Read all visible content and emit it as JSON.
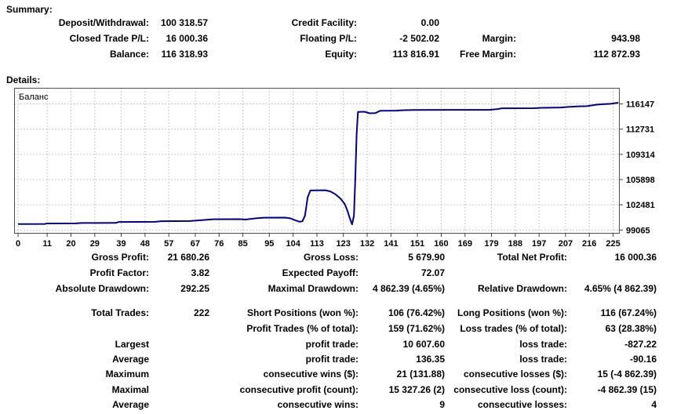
{
  "headers": {
    "summary": "Summary:",
    "details": "Details:"
  },
  "summary": {
    "rows": [
      {
        "c1l": "Deposit/Withdrawal:",
        "c1v": "100 318.57",
        "c2l": "Credit Facility:",
        "c2v": "0.00",
        "c3l": "",
        "c3v": ""
      },
      {
        "c1l": "Closed Trade P/L:",
        "c1v": "16 000.36",
        "c2l": "Floating P/L:",
        "c2v": "-2 502.02",
        "c3l": "Margin:",
        "c3v": "943.98"
      },
      {
        "c1l": "Balance:",
        "c1v": "116 318.93",
        "c2l": "Equity:",
        "c2v": "113 816.91",
        "c3l": "Free Margin:",
        "c3v": "112 872.93"
      }
    ]
  },
  "results": {
    "rows": [
      {
        "c1l": "Gross Profit:",
        "c1v": "21 680.26",
        "c2l": "Gross Loss:",
        "c2v": "5 679.90",
        "c3l": "Total Net Profit:",
        "c3v": "16 000.36"
      },
      {
        "c1l": "Profit Factor:",
        "c1v": "3.82",
        "c2l": "Expected Payoff:",
        "c2v": "72.07",
        "c3l": "",
        "c3v": ""
      },
      {
        "c1l": "Absolute Drawdown:",
        "c1v": "292.25",
        "c2l": "Maximal Drawdown:",
        "c2v": "4 862.39 (4.65%)",
        "c3l": "Relative Drawdown:",
        "c3v": "4.65% (4 862.39)"
      }
    ]
  },
  "trades": {
    "rows": [
      {
        "c1l": "Total Trades:",
        "c1v": "222",
        "c2l": "Short Positions (won %):",
        "c2v": "106 (76.42%)",
        "c3l": "Long Positions (won %):",
        "c3v": "116 (67.24%)"
      },
      {
        "c1l": "",
        "c1v": "",
        "c2l": "Profit Trades (% of total):",
        "c2v": "159 (71.62%)",
        "c3l": "Loss trades (% of total):",
        "c3v": "63 (28.38%)"
      },
      {
        "c1l": "Largest",
        "c1v": "",
        "c2l": "profit trade:",
        "c2v": "10 607.60",
        "c3l": "loss trade:",
        "c3v": "-827.22"
      },
      {
        "c1l": "Average",
        "c1v": "",
        "c2l": "profit trade:",
        "c2v": "136.35",
        "c3l": "loss trade:",
        "c3v": "-90.16"
      },
      {
        "c1l": "Maximum",
        "c1v": "",
        "c2l": "consecutive wins ($):",
        "c2v": "21 (131.88)",
        "c3l": "consecutive losses ($):",
        "c3v": "15 (-4 862.39)"
      },
      {
        "c1l": "Maximal",
        "c1v": "",
        "c2l": "consecutive profit (count):",
        "c2v": "15 327.26 (2)",
        "c3l": "consecutive loss (count):",
        "c3v": "-4 862.39 (15)"
      },
      {
        "c1l": "Average",
        "c1v": "",
        "c2l": "consecutive wins:",
        "c2v": "9",
        "c3l": "consecutive losses:",
        "c3v": "4"
      }
    ]
  },
  "chart_data": {
    "type": "line",
    "title": "Баланс",
    "xlabel": "",
    "ylabel": "",
    "grid": true,
    "legend_position": "inside-top-left",
    "x_ticks": [
      0,
      11,
      20,
      29,
      39,
      48,
      57,
      67,
      76,
      85,
      95,
      104,
      113,
      123,
      132,
      141,
      151,
      160,
      169,
      179,
      188,
      197,
      207,
      216,
      225
    ],
    "y_ticks": [
      99065,
      102481,
      105898,
      109314,
      112731,
      116147
    ],
    "xlim": [
      -1.5,
      227.5
    ],
    "ylim": [
      98570,
      118330
    ],
    "colors": {
      "line": "#00008B",
      "grid": "#c8c8c8",
      "border": "#4d4d4d",
      "tick": "#404040"
    },
    "series": [
      {
        "name": "Баланс",
        "points": [
          [
            0,
            99880
          ],
          [
            10,
            99890
          ],
          [
            11,
            99950
          ],
          [
            22,
            99960
          ],
          [
            24,
            100010
          ],
          [
            37,
            100030
          ],
          [
            38,
            100150
          ],
          [
            52,
            100170
          ],
          [
            54,
            100260
          ],
          [
            65,
            100280
          ],
          [
            67,
            100330
          ],
          [
            70,
            100420
          ],
          [
            74,
            100520
          ],
          [
            84,
            100540
          ],
          [
            86,
            100480
          ],
          [
            90,
            100650
          ],
          [
            93,
            100740
          ],
          [
            101,
            100750
          ],
          [
            103,
            100640
          ],
          [
            105,
            100350
          ],
          [
            106.5,
            100180
          ],
          [
            107.5,
            100250
          ],
          [
            108.5,
            101000
          ],
          [
            109.5,
            103500
          ],
          [
            110.5,
            104420
          ],
          [
            116,
            104460
          ],
          [
            118,
            104310
          ],
          [
            120,
            103900
          ],
          [
            122,
            103300
          ],
          [
            123.5,
            102600
          ],
          [
            124.5,
            101700
          ],
          [
            125.5,
            100600
          ],
          [
            126.3,
            99830
          ],
          [
            127,
            101000
          ],
          [
            127.5,
            106000
          ],
          [
            128,
            112000
          ],
          [
            128.5,
            115060
          ],
          [
            131,
            115090
          ],
          [
            133,
            114880
          ],
          [
            135,
            114900
          ],
          [
            137,
            115230
          ],
          [
            143,
            115240
          ],
          [
            146,
            115300
          ],
          [
            150,
            115330
          ],
          [
            162,
            115340
          ],
          [
            178,
            115350
          ],
          [
            181,
            115430
          ],
          [
            183,
            115560
          ],
          [
            195,
            115570
          ],
          [
            198,
            115620
          ],
          [
            205,
            115660
          ],
          [
            208,
            115740
          ],
          [
            212,
            115820
          ],
          [
            215,
            115840
          ],
          [
            217,
            115950
          ],
          [
            219,
            116060
          ],
          [
            221,
            116110
          ],
          [
            224,
            116160
          ],
          [
            227,
            116310
          ]
        ]
      }
    ]
  }
}
